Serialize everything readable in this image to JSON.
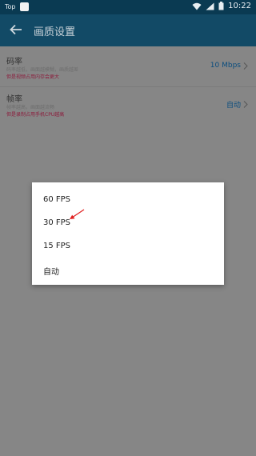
{
  "status_bar": {
    "app_label": "Top",
    "time": "10:22"
  },
  "toolbar": {
    "title": "画质设置"
  },
  "settings": [
    {
      "label": "码率",
      "desc1": "码率越低，画面越模糊，画质越差",
      "desc2": "但是视频占用内存会更大",
      "value": "10 Mbps"
    },
    {
      "label": "帧率",
      "desc1": "帧率越高，画面越流畅",
      "desc2": "但是录制占用手机CPU越高",
      "value": "自动"
    }
  ],
  "dialog": {
    "options": [
      "60 FPS",
      "30 FPS",
      "15 FPS",
      "自动"
    ]
  },
  "colors": {
    "status_bar": "#0a3a52",
    "toolbar": "#124a66",
    "accent_value": "#0b4d7e",
    "warning_text": "#8c1c3c",
    "annotation_arrow": "#e02020"
  }
}
